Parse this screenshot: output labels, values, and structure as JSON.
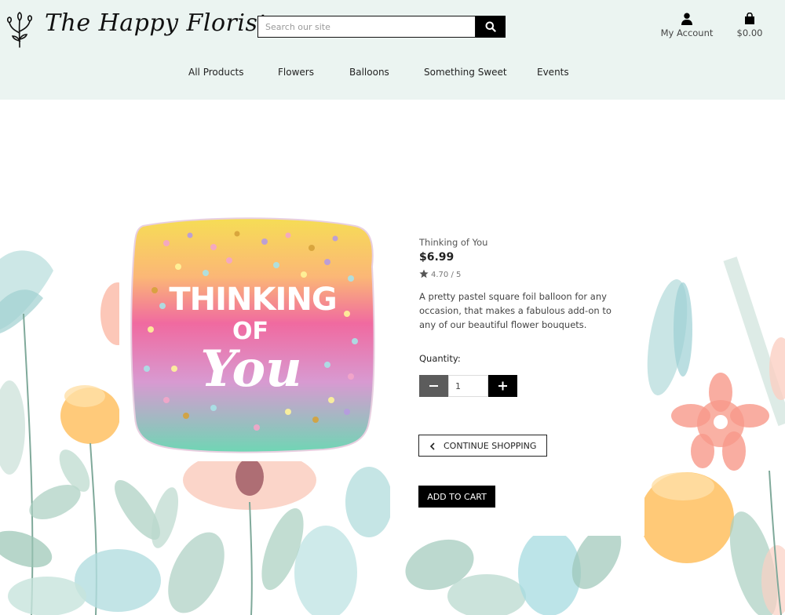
{
  "header": {
    "brand": "The Happy Florist",
    "logo_icon": "floral-sprig-icon",
    "search": {
      "placeholder": "Search our site",
      "value": "",
      "icon": "search-icon"
    },
    "account_label": "My Account",
    "account_icon": "user-icon",
    "cart_total": "$0.00",
    "cart_icon": "shopping-bag-icon"
  },
  "nav": {
    "items": [
      {
        "label": "All Products"
      },
      {
        "label": "Flowers"
      },
      {
        "label": "Balloons"
      },
      {
        "label": "Something Sweet"
      },
      {
        "label": "Events"
      }
    ]
  },
  "product": {
    "name": "Thinking of You",
    "price": "$6.99",
    "rating": "4.70 / 5",
    "rating_icon": "star-icon",
    "description": "A pretty pastel square foil balloon for any occasion, that makes a fabulous add-on to any of our beautiful flower bouquets.",
    "image_text": {
      "line1": "THINKING",
      "line2": "OF",
      "line3": "You"
    },
    "quantity_label": "Quantity:",
    "quantity_value": "1",
    "minus_icon": "minus-icon",
    "plus_icon": "plus-icon",
    "continue_label": "Continue Shopping",
    "continue_icon": "chevron-left-icon",
    "add_to_cart_label": "Add to Cart"
  },
  "colors": {
    "header_bg": "#ebf4f1",
    "button_dark": "#000000",
    "minus_button": "#5c5c5c"
  }
}
